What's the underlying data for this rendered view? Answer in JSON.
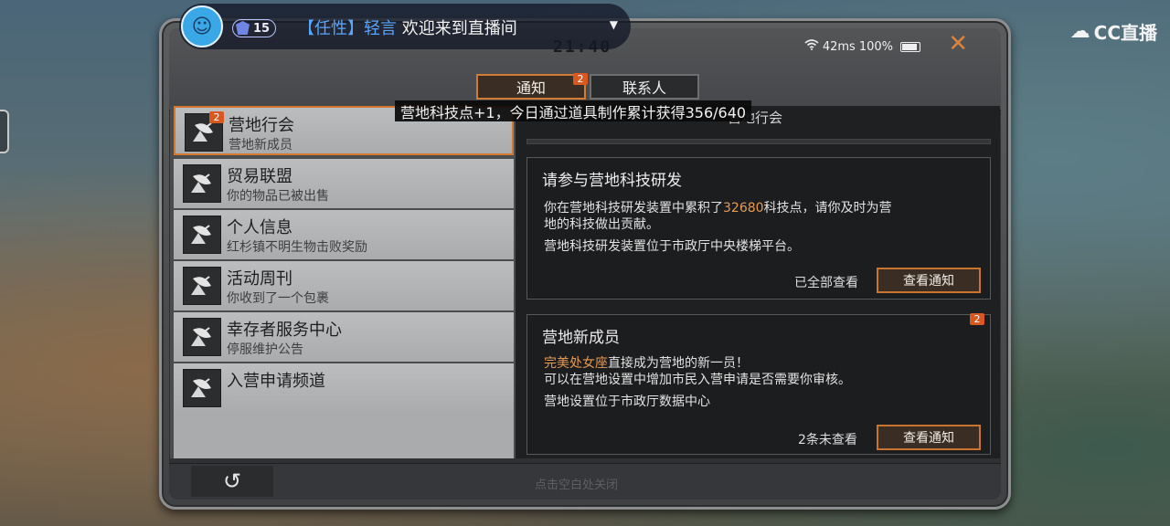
{
  "stream": {
    "user": "【任性】轻言",
    "message": "欢迎来到直播间",
    "level": "15"
  },
  "platform_logo": "CC直播",
  "status": {
    "time": "21:40",
    "ping": "42ms",
    "battery": "100%"
  },
  "tabs": [
    {
      "label": "通知",
      "badge": "2",
      "active": true
    },
    {
      "label": "联系人",
      "active": false
    }
  ],
  "tooltip": "营地科技点+1，今日通过道具制作累计获得356/640",
  "list": [
    {
      "title": "营地行会",
      "subtitle": "营地新成员",
      "badge": "2",
      "selected": true
    },
    {
      "title": "贸易联盟",
      "subtitle": "你的物品已被出售"
    },
    {
      "title": "个人信息",
      "subtitle": "红杉镇不明生物击败奖励"
    },
    {
      "title": "活动周刊",
      "subtitle": "你收到了一个包裹"
    },
    {
      "title": "幸存者服务中心",
      "subtitle": "停服维护公告"
    },
    {
      "title": "入营申请频道",
      "subtitle": ""
    }
  ],
  "detail": {
    "header": "营地行会",
    "cards": [
      {
        "title": "请参与营地科技研发",
        "line1_a": "你在营地科技研发装置中累积了",
        "line1_highlight": "32680",
        "line1_b": "科技点，请你及时为营",
        "line2": "地的科技做出贡献。",
        "line3": "营地科技研发装置位于市政厅中央楼梯平台。",
        "status": "已全部查看",
        "button": "查看通知"
      },
      {
        "title": "营地新成员",
        "badge": "2",
        "line1_highlight": "完美处女座",
        "line1_b": "直接成为营地的新一员！",
        "line2": "可以在营地设置中增加市民入营申请是否需要你审核。",
        "line3": "营地设置位于市政厅数据中心",
        "status": "2条未查看",
        "button": "查看通知"
      }
    ]
  },
  "bottom": {
    "back": "↺",
    "hint": "点击空白处关闭"
  },
  "colors": {
    "accent": "#d47b33",
    "badge": "#d8581f",
    "highlight": "#e69a53",
    "stream_user": "#58a6ff"
  }
}
